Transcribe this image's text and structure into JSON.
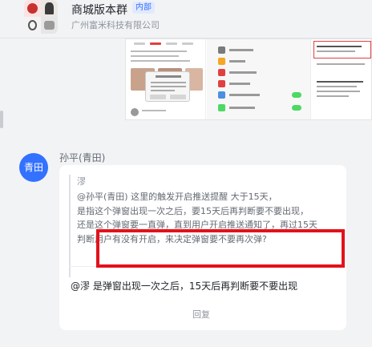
{
  "header": {
    "group_name": "商城版本群",
    "badge": "内部",
    "company": "广州富米科技有限公司"
  },
  "message": {
    "sender": "孙平(青田)",
    "avatar_text": "青田",
    "quote": {
      "author": "漻",
      "body": "@孙平(青田) 这里的触发开启推送提醒 大于15天，\n是指这个弹窗出现一次之后，要15天后再判断要不要出现，\n还是这个弹窗要一直弹，直到用户开启推送通知了，再过15天\n判断用户有没有开启，来决定弹窗要不要再次弹?"
    },
    "reply_mention": "@漻",
    "reply_text": "是弹窗出现一次之后，15天后再判断要不要出现",
    "reply_button": "回复"
  },
  "colors": {
    "accent": "#3371ff",
    "highlight": "#e3111b",
    "badge_bg": "#e1eaff"
  },
  "icons": {
    "avatar": "group-avatar",
    "embedded": "screenshot-image"
  }
}
